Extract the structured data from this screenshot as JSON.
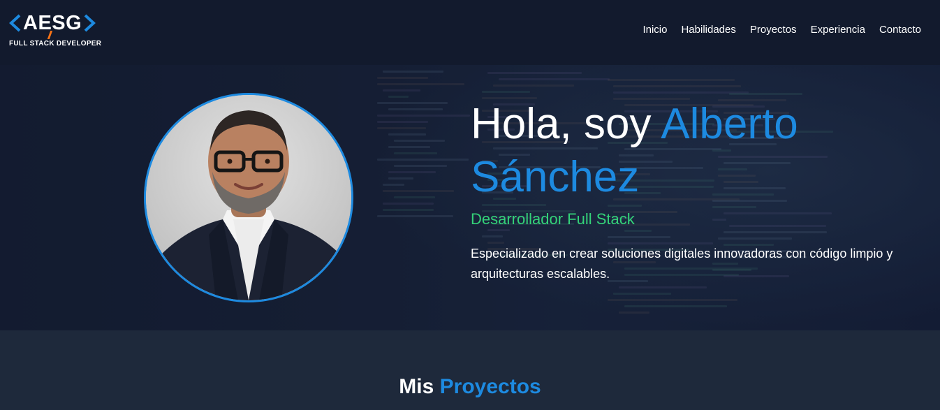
{
  "logo": {
    "text": "AESG",
    "subtitle": "FULL STACK DEVELOPER",
    "chevron_color": "#1d8ae0",
    "slash_color": "#f97316"
  },
  "nav": {
    "items": [
      "Inicio",
      "Habilidades",
      "Proyectos",
      "Experiencia",
      "Contacto"
    ]
  },
  "hero": {
    "greeting": "Hola, soy ",
    "name_first": "Alberto",
    "name_last": "Sánchez",
    "role": "Desarrollador Full Stack",
    "description": "Especializado en crear soluciones digitales innovadoras con código limpio y arquitecturas escalables.",
    "avatar_icon": "profile-photo",
    "accent_color": "#1d8ae0",
    "role_color": "#34d279"
  },
  "projects": {
    "title_prefix": "Mis ",
    "title_accent": "Proyectos"
  }
}
